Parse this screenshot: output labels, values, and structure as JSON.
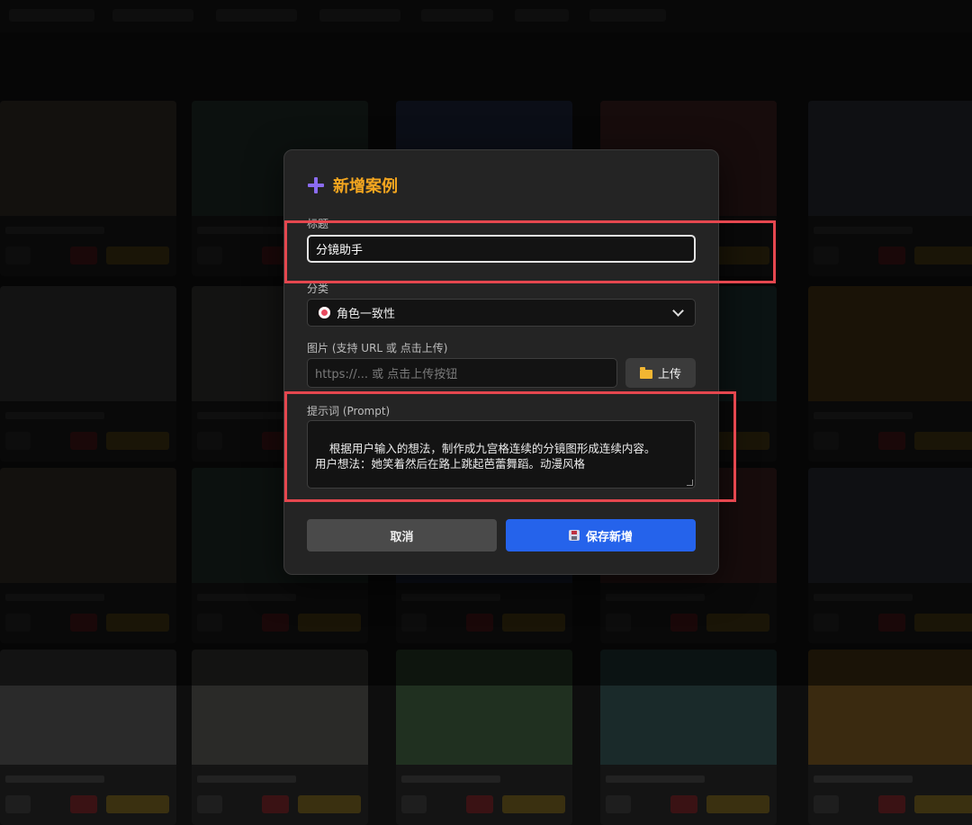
{
  "colors": {
    "accent_title": "#f4a61f",
    "plus_icon": "#8b6cf0",
    "primary_button": "#2563eb",
    "highlight_box": "#e5474f"
  },
  "modal": {
    "title": "新增案例",
    "title_label": "标题",
    "title_value": "分镜助手",
    "category_label": "分类",
    "category_selected": "角色一致性",
    "image_label": "图片 (支持 URL 或 点击上传)",
    "image_placeholder": "https://... 或 点击上传按钮",
    "upload_label": "上传",
    "prompt_label": "提示词 (Prompt)",
    "prompt_value": "根据用户输入的想法，制作成九宫格连续的分镜图形成连续内容。\n用户想法：她笑着然后在路上跳起芭蕾舞蹈。动漫风格",
    "cancel_label": "取消",
    "save_label": "保存新增"
  },
  "icons": [
    "plus-icon",
    "target-icon",
    "chevron-down-icon",
    "folder-icon",
    "floppy-disk-icon"
  ]
}
